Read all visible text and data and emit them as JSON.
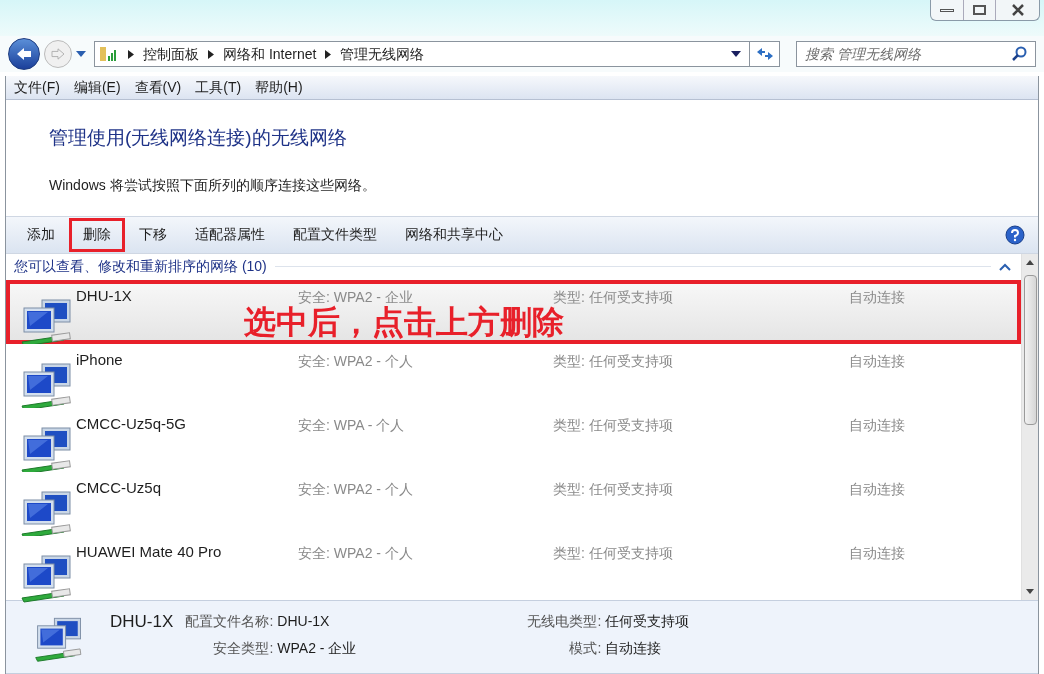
{
  "breadcrumb": [
    "控制面板",
    "网络和 Internet",
    "管理无线网络"
  ],
  "search": {
    "placeholder": "搜索 管理无线网络"
  },
  "menu": [
    "文件(F)",
    "编辑(E)",
    "查看(V)",
    "工具(T)",
    "帮助(H)"
  ],
  "heading": "管理使用(无线网络连接)的无线网络",
  "description": "Windows 将尝试按照下面所列的顺序连接这些网络。",
  "toolbar": [
    {
      "label": "添加",
      "highlighted": false
    },
    {
      "label": "删除",
      "highlighted": true
    },
    {
      "label": "下移",
      "highlighted": false
    },
    {
      "label": "适配器属性",
      "highlighted": false
    },
    {
      "label": "配置文件类型",
      "highlighted": false
    },
    {
      "label": "网络和共享中心",
      "highlighted": false
    }
  ],
  "group_header": "您可以查看、修改和重新排序的网络 (10)",
  "networks": [
    {
      "name": "DHU-1X",
      "security": "安全: WPA2 - 企业",
      "type": "类型: 任何受支持项",
      "mode": "自动连接",
      "selected": true,
      "highlighted": true
    },
    {
      "name": "iPhone",
      "security": "安全: WPA2 - 个人",
      "type": "类型: 任何受支持项",
      "mode": "自动连接",
      "selected": false,
      "highlighted": false
    },
    {
      "name": "CMCC-Uz5q-5G",
      "security": "安全: WPA - 个人",
      "type": "类型: 任何受支持项",
      "mode": "自动连接",
      "selected": false,
      "highlighted": false
    },
    {
      "name": "CMCC-Uz5q",
      "security": "安全: WPA2 - 个人",
      "type": "类型: 任何受支持项",
      "mode": "自动连接",
      "selected": false,
      "highlighted": false
    },
    {
      "name": "HUAWEI Mate 40 Pro",
      "security": "安全: WPA2 - 个人",
      "type": "类型: 任何受支持项",
      "mode": "自动连接",
      "selected": false,
      "highlighted": false
    }
  ],
  "annotation": "选中后，点击上方删除",
  "details": {
    "name": "DHU-1X",
    "fields": [
      {
        "label": "配置文件名称:",
        "value": "DHU-1X"
      },
      {
        "label": "无线电类型:",
        "value": "任何受支持项"
      },
      {
        "label": "安全类型:",
        "value": "WPA2 - 企业"
      },
      {
        "label": "模式:",
        "value": "自动连接"
      }
    ]
  }
}
